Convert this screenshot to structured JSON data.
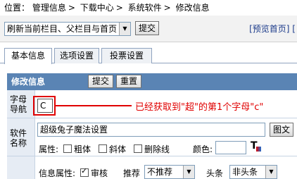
{
  "breadcrumb": {
    "prefix": "位置：",
    "items": [
      "管理信息",
      "下载中心",
      "系统软件",
      "修改信息"
    ],
    "separator": ">"
  },
  "toolbar": {
    "refresh_select": "刷新当前栏目、父栏目与首页",
    "submit_label": "提交",
    "links_text": "[预览首页] ["
  },
  "tabs": [
    "基本信息",
    "选项设置",
    "投票设置"
  ],
  "form": {
    "header_title": "修改信息",
    "submit_label": "提交",
    "reset_label": "重置",
    "letter_label": "字母导航",
    "letter_value": "C",
    "annotation": "已经获取到\"超\"的第1个字母\"c\"",
    "name_label": "软件名称",
    "name_value": "超级兔子魔法设置",
    "image_button": "图文",
    "attr_label": "属性:",
    "bold": "粗体",
    "italic": "斜体",
    "strike": "删除线",
    "color_label": "颜色:",
    "info_attr_label": "信息属性:",
    "review": "审核",
    "recommend_label": "推荐",
    "recommend_value": "不推荐",
    "headline_label": "头条",
    "headline_value": "非头条"
  },
  "colors": {
    "header_bg": "#5a84b4",
    "annotation_red": "#e00000",
    "link_blue": "#1b3a8a"
  }
}
